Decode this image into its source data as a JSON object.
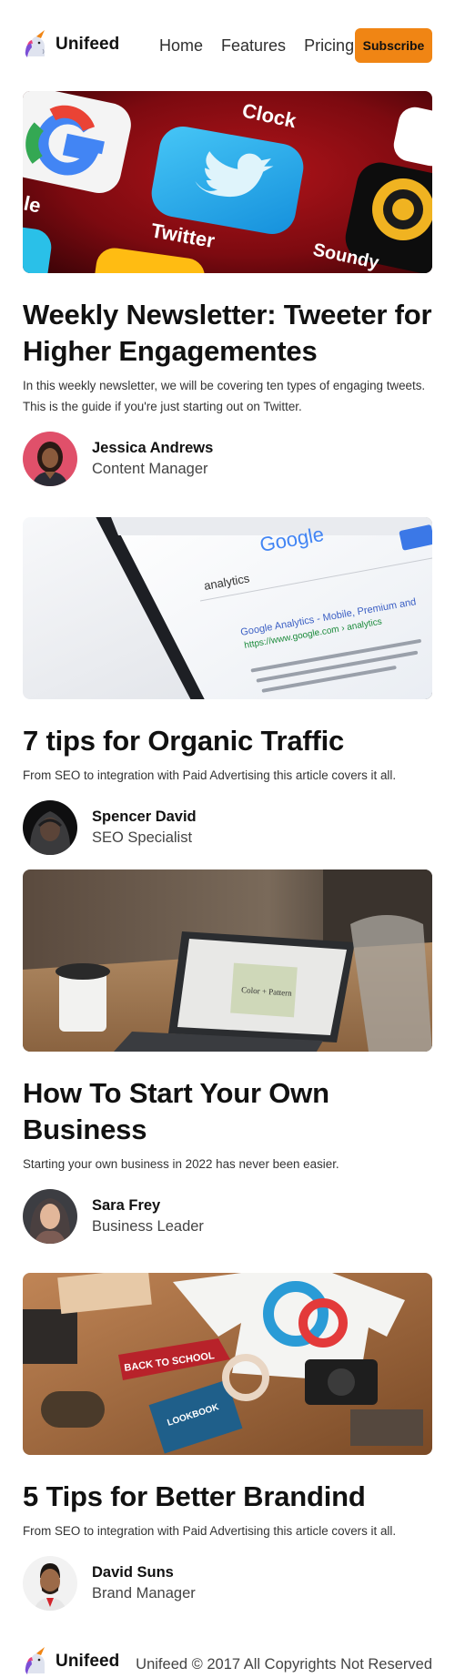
{
  "brand": {
    "name": "Unifeed"
  },
  "nav": {
    "items": [
      "Home",
      "Features",
      "Pricing"
    ],
    "subscribe_label": "Subscribe"
  },
  "colors": {
    "accent": "#f08514",
    "text": "#111111",
    "muted": "#444444"
  },
  "articles": [
    {
      "image_icon": "twitter-app-icon-photo",
      "image_text": {
        "clock": "Clock",
        "twitter": "Twitter",
        "sound": "Soundy",
        "le": "le"
      },
      "title": "Weekly Newsletter: Tweeter for Higher Engagementes",
      "excerpt": "In this weekly newsletter, we will be covering ten types of engaging tweets. This is the guide if you're just starting out on Twitter.",
      "author": {
        "name": "Jessica Andrews",
        "role": "Content Manager"
      }
    },
    {
      "image_icon": "google-search-phone-photo",
      "image_text": {
        "google": "Google",
        "query": "analytics",
        "result_title": "Google Analytics - Mobile, Premium and",
        "result_url": "https://www.google.com › analytics"
      },
      "title": "7 tips for Organic Traffic",
      "excerpt": "From SEO to integration with Paid Advertising this article covers it all.",
      "author": {
        "name": "Spencer David",
        "role": "SEO Specialist"
      }
    },
    {
      "image_icon": "laptop-desk-photo",
      "image_text": {
        "slide": "Color + Pattern"
      },
      "title": "How To Start Your Own Business",
      "excerpt": "Starting your own business in 2022 has never been easier.",
      "author": {
        "name": "Sara Frey",
        "role": "Business Leader"
      }
    },
    {
      "image_icon": "branding-flatlay-photo",
      "image_text": {
        "pennant": "BACK TO SCHOOL",
        "book": "LOOKBOOK"
      },
      "title": "5 Tips for Better Brandind",
      "excerpt": "From SEO to integration with Paid Advertising this article covers it all.",
      "author": {
        "name": "David Suns",
        "role": "Brand Manager"
      }
    }
  ],
  "footer": {
    "brand": "Unifeed",
    "copyright": "Unifeed © 2017 All Copyrights Not Reserved"
  }
}
